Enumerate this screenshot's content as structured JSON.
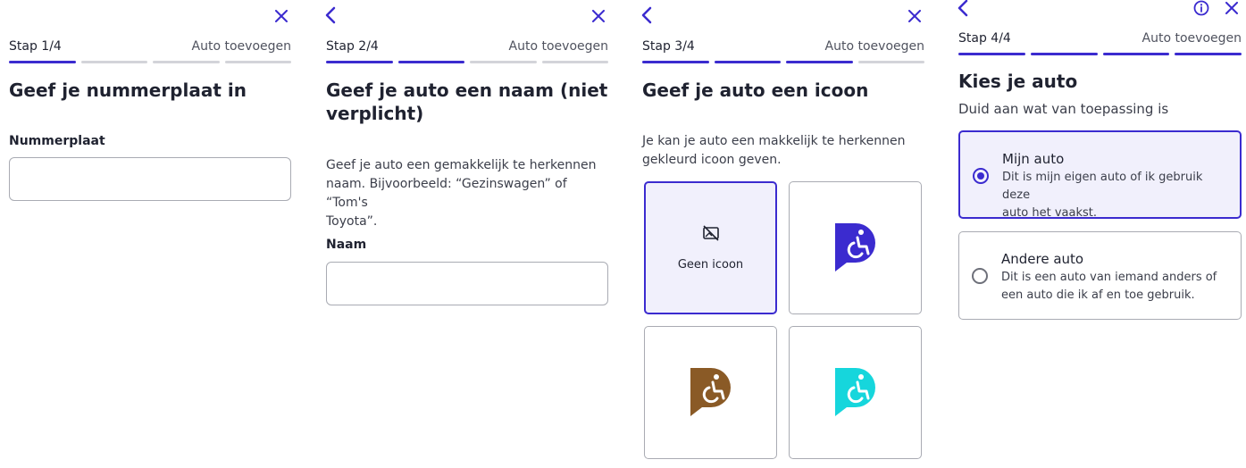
{
  "colors": {
    "accent": "#3b2bcf",
    "inactive_segment": "#d3d4d9",
    "selected_bg": "#f1f0fc"
  },
  "screens": [
    {
      "step": "Stap 1/4",
      "header_action": "Auto toevoegen",
      "progress_done": 1,
      "title": "Geef je nummerplaat in",
      "field_label": "Nummerplaat",
      "field_value": ""
    },
    {
      "step": "Stap 2/4",
      "header_action": "Auto toevoegen",
      "progress_done": 2,
      "title_line1": "Geef je auto een naam (niet",
      "title_line2": "verplicht)",
      "desc_line1": "Geef je auto een gemakkelijk te herkennen",
      "desc_line2": "naam. Bijvoorbeeld: “Gezinswagen” of “Tom's",
      "desc_line3": "Toyota”.",
      "field_label": "Naam",
      "field_value": ""
    },
    {
      "step": "Stap 3/4",
      "header_action": "Auto toevoegen",
      "progress_done": 3,
      "title": "Geef je auto een icoon",
      "desc_line1": "Je kan je auto een makkelijk te herkennen",
      "desc_line2": "gekleurd icoon geven.",
      "icons": [
        {
          "label": "Geen icoon",
          "icon": "no-image-icon",
          "selected": true
        },
        {
          "icon": "parking-accessible-icon",
          "color": "#3b2bcf",
          "selected": false
        },
        {
          "icon": "parking-accessible-icon",
          "color": "#8a5a26",
          "selected": false
        },
        {
          "icon": "parking-accessible-icon",
          "color": "#16d6dc",
          "selected": false
        }
      ]
    },
    {
      "step": "Stap 4/4",
      "header_action": "Auto toevoegen",
      "progress_done": 4,
      "title": "Kies je auto",
      "subtitle": "Duid aan wat van toepassing is",
      "options": [
        {
          "title": "Mijn auto",
          "desc_line1": "Dit is mijn eigen auto of ik gebruik deze",
          "desc_line2": "auto het vaakst.",
          "selected": true
        },
        {
          "title": "Andere auto",
          "desc_line1": "Dit is een auto van iemand anders of",
          "desc_line2": "een auto die ik af en toe gebruik.",
          "selected": false
        }
      ]
    }
  ]
}
